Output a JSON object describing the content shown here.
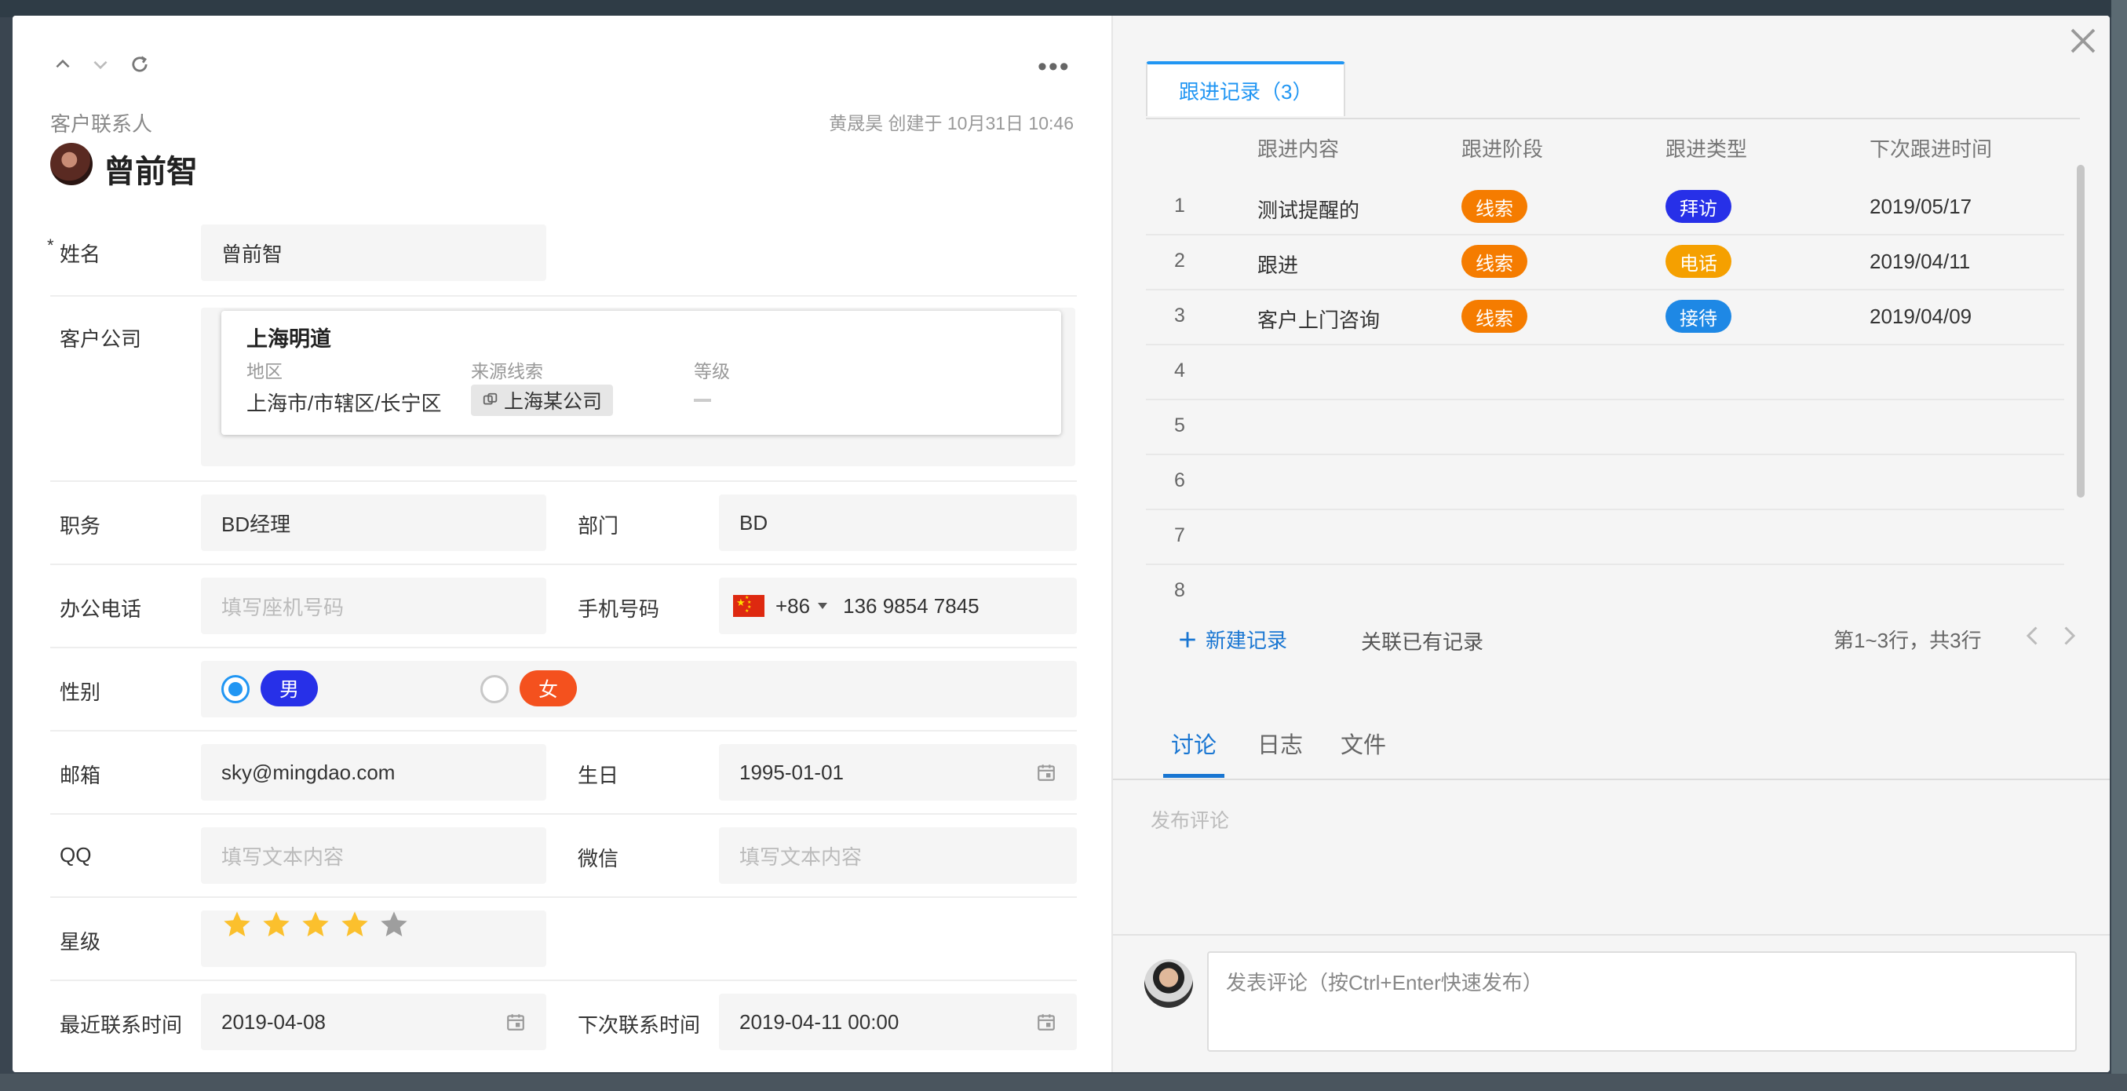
{
  "record": {
    "object_type": "客户联系人",
    "creator_info": "黄晟昊 创建于 10月31日 10:46",
    "name_title": "曾前智",
    "more_label": "•••"
  },
  "fields": {
    "name": {
      "label": "姓名",
      "required_mark": "*",
      "value": "曾前智"
    },
    "company": {
      "label": "客户公司",
      "card_name": "上海明道",
      "region_label": "地区",
      "region_value": "上海市/市辖区/长宁区",
      "source_label": "来源线索",
      "source_value": "上海某公司",
      "level_label": "等级"
    },
    "position": {
      "label": "职务",
      "value": "BD经理"
    },
    "department": {
      "label": "部门",
      "value": "BD"
    },
    "office_phone": {
      "label": "办公电话",
      "placeholder": "填写座机号码"
    },
    "mobile": {
      "label": "手机号码",
      "country_code": "+86",
      "value": "136 9854 7845"
    },
    "gender": {
      "label": "性别",
      "options": [
        "男",
        "女"
      ],
      "selected": "男",
      "colors": [
        "#2730e8",
        "#f4511e"
      ]
    },
    "email": {
      "label": "邮箱",
      "value": "sky@mingdao.com"
    },
    "birthday": {
      "label": "生日",
      "value": "1995-01-01"
    },
    "qq": {
      "label": "QQ",
      "placeholder": "填写文本内容"
    },
    "wechat": {
      "label": "微信",
      "placeholder": "填写文本内容"
    },
    "rating": {
      "label": "星级",
      "value": 4,
      "max": 5
    },
    "last_contact": {
      "label": "最近联系时间",
      "value": "2019-04-08"
    },
    "next_contact": {
      "label": "下次联系时间",
      "value": "2019-04-11 00:00"
    }
  },
  "followups": {
    "tab_label": "跟进记录（3）",
    "columns": [
      "跟进内容",
      "跟进阶段",
      "跟进类型",
      "下次跟进时间"
    ],
    "row_numbers": [
      "1",
      "2",
      "3",
      "4",
      "5",
      "6",
      "7",
      "8"
    ],
    "rows": [
      {
        "content": "测试提醒的",
        "stage": "线索",
        "type": "拜访",
        "next_time": "2019/05/17",
        "type_color": "#2730e8"
      },
      {
        "content": "跟进",
        "stage": "线索",
        "type": "电话",
        "next_time": "2019/04/11",
        "type_color": "#f5a000"
      },
      {
        "content": "客户上门咨询",
        "stage": "线索",
        "type": "接待",
        "next_time": "2019/04/09",
        "type_color": "#1e88e5"
      }
    ],
    "stage_color": "#f57c00",
    "new_record": "新建记录",
    "link_existing": "关联已有记录",
    "pagination": "第1~3行，共3行"
  },
  "discussion": {
    "tabs": [
      "讨论",
      "日志",
      "文件"
    ],
    "active_tab": "讨论",
    "post_hint": "发布评论",
    "comment_placeholder": "发表评论（按Ctrl+Enter快速发布）"
  },
  "colors": {
    "accent": "#2196f3",
    "link": "#1976d2",
    "star_on": "#fbc02d",
    "star_off": "#9e9e9e"
  }
}
